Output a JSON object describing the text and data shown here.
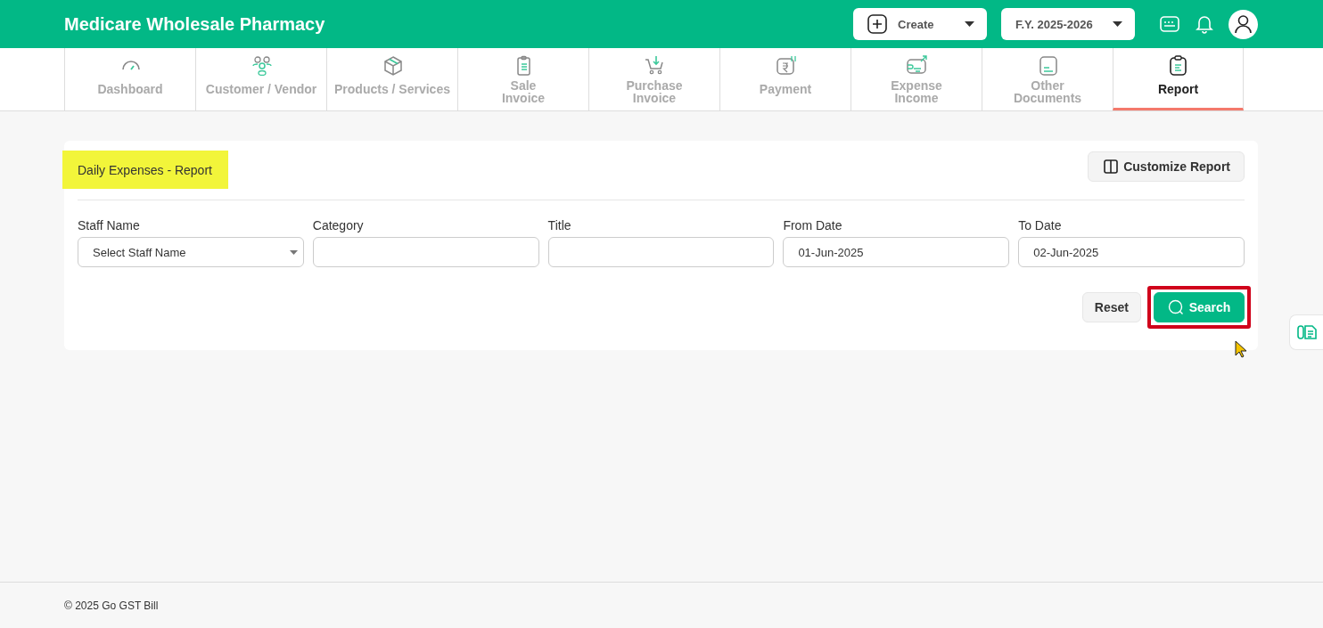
{
  "header": {
    "title": "Medicare Wholesale Pharmacy",
    "create_button": "Create",
    "year_select": "F.Y. 2025-2026"
  },
  "tabs": [
    {
      "label": "Dashboard",
      "selected": false
    },
    {
      "label": "Customer / Vendor",
      "selected": false
    },
    {
      "label": "Products / Services",
      "selected": false
    },
    {
      "label": "Sale\nInvoice",
      "selected": false
    },
    {
      "label": "Purchase\nInvoice",
      "selected": false
    },
    {
      "label": "Payment",
      "selected": false
    },
    {
      "label": "Expense\nIncome",
      "selected": false
    },
    {
      "label": "Other\nDocuments",
      "selected": false
    },
    {
      "label": "Report",
      "selected": true
    }
  ],
  "report": {
    "title": "Daily Expenses - Report",
    "customize_button": "Customize Report",
    "filters": [
      {
        "kind": "select",
        "label": "Staff Name",
        "placeholder": "Select Staff Name"
      },
      {
        "kind": "input",
        "label": "Category"
      },
      {
        "kind": "input",
        "label": "Title"
      },
      {
        "kind": "input",
        "label": "From Date",
        "value": "01-Jun-2025"
      },
      {
        "kind": "input",
        "label": "To Date",
        "value": "02-Jun-2025"
      }
    ],
    "reset_button": "Reset",
    "search_button": "Search"
  },
  "footer": {
    "text": "© 2025 Go GST Bill"
  }
}
